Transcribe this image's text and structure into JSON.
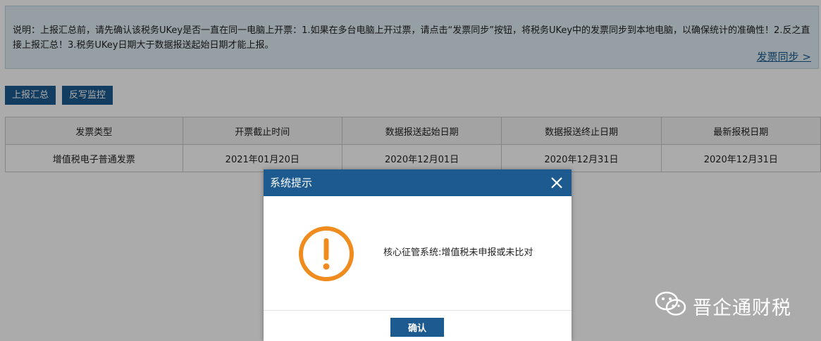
{
  "notice": {
    "text": "说明：上报汇总前，请先确认该税务UKey是否一直在同一电脑上开票：1.如果在多台电脑上开过票，请点击“发票同步”按钮，将税务UKey中的发票同步到本地电脑，以确保统计的准确性！2.反之直接上报汇总！3.税务UKey日期大于数据报送起始日期才能上报。",
    "sync_link": "发票同步 >"
  },
  "toolbar": {
    "report_summary": "上报汇总",
    "reverse_monitor": "反写监控"
  },
  "table": {
    "headers": [
      "发票类型",
      "开票截止时间",
      "数据报送起始日期",
      "数据报送终止日期",
      "最新报税日期"
    ],
    "rows": [
      [
        "增值税电子普通发票",
        "2021年01月20日",
        "2020年12月01日",
        "2020年12月31日",
        "2020年12月31日"
      ]
    ]
  },
  "dialog": {
    "title": "系统提示",
    "message": "核心征管系统:增值税未申报或未比对",
    "ok_label": "确认",
    "icon": "warning-icon",
    "accent_color": "#f08c1e"
  },
  "watermark": {
    "text": "晋企通财税",
    "icon": "wechat-icon"
  },
  "colors": {
    "primary": "#1c5a8f",
    "notice_bg": "#dfeef5"
  }
}
